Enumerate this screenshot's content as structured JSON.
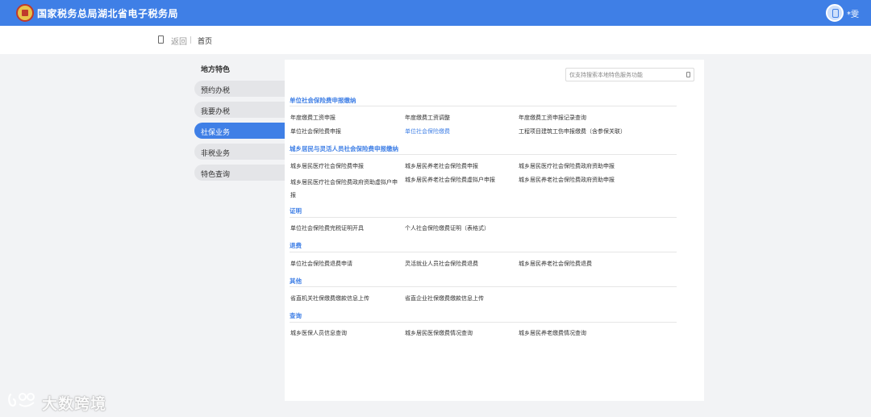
{
  "header": {
    "site_title": "国家税务总局湖北省电子税务局",
    "user_name": "*雯"
  },
  "nav": {
    "back_label": "返回",
    "home_label": "首页"
  },
  "sidebar": {
    "title": "地方特色",
    "items": [
      {
        "label": "预约办税",
        "active": false
      },
      {
        "label": "我要办税",
        "active": false
      },
      {
        "label": "社保业务",
        "active": true
      },
      {
        "label": "非税业务",
        "active": false
      },
      {
        "label": "特色查询",
        "active": false
      }
    ]
  },
  "search": {
    "placeholder": "仅支持搜索本地特色服务功能"
  },
  "sections": [
    {
      "title": "单位社会保险费申报缴纳",
      "rows": [
        [
          "年度缴费工资申报",
          "年度缴费工资调整",
          "年度缴费工资申报记录查询"
        ],
        [
          "单位社会保险费申报",
          "单位社会保险缴费",
          "工程项目建筑工伤申报缴费（含参保关联）"
        ]
      ]
    },
    {
      "title": "城乡居民与灵活人员社会保险费申报缴纳",
      "rows": [
        [
          "城乡居民医疗社会保险费申报",
          "城乡居民养老社会保险费申报",
          "城乡居民医疗社会保险费政府资助申报"
        ],
        [
          "城乡居民医疗社会保险费政府资助虚拟户申报",
          "城乡居民养老社会保险费虚拟户申报",
          "城乡居民养老社会保险费政府资助申报"
        ]
      ]
    },
    {
      "title": "证明",
      "rows": [
        [
          "单位社会保险费完税证明开具",
          "个人社会保险缴费证明（表格式）",
          ""
        ]
      ]
    },
    {
      "title": "退费",
      "rows": [
        [
          "单位社会保险费退费申请",
          "灵活就业人员社会保险费退费",
          "城乡居民养老社会保险费退费"
        ]
      ]
    },
    {
      "title": "其他",
      "rows": [
        [
          "省直机关社保缴费缴款信息上传",
          "省直企业社保缴费缴款信息上传",
          ""
        ]
      ]
    },
    {
      "title": "查询",
      "rows": [
        [
          "城乡医保人员信息查询",
          "城乡居民医保缴费情况查询",
          "城乡居民养老缴费情况查询"
        ]
      ]
    }
  ],
  "highlighted_link": "单位社会保险缴费",
  "watermark": {
    "text": "大数跨境"
  },
  "colors": {
    "brand_blue": "#3f7fe6",
    "page_bg": "#f2f3f5"
  }
}
